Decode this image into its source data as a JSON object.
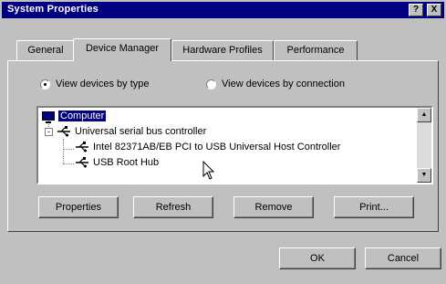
{
  "window": {
    "title": "System Properties",
    "help_label": "?",
    "close_label": "X"
  },
  "tabs": [
    {
      "label": "General"
    },
    {
      "label": "Device Manager"
    },
    {
      "label": "Hardware Profiles"
    },
    {
      "label": "Performance"
    }
  ],
  "view_options": {
    "by_type_label": "View devices by type",
    "by_connection_label": "View devices by connection",
    "selected": "by_type"
  },
  "device_tree": {
    "items": [
      {
        "label": "Computer",
        "selected": true
      },
      {
        "label": "Universal serial bus controller",
        "expander": "-"
      },
      {
        "label": "Intel 82371AB/EB PCI to USB Universal Host Controller"
      },
      {
        "label": "USB Root Hub"
      }
    ],
    "scroll_up": "▲",
    "scroll_down": "▼"
  },
  "actions": {
    "properties_label": "Properties",
    "refresh_label": "Refresh",
    "remove_label": "Remove",
    "print_label": "Print..."
  },
  "dialog": {
    "ok_label": "OK",
    "cancel_label": "Cancel"
  },
  "colors": {
    "title_bar": "#000080",
    "face": "#c0c0c0",
    "selection": "#000080"
  }
}
